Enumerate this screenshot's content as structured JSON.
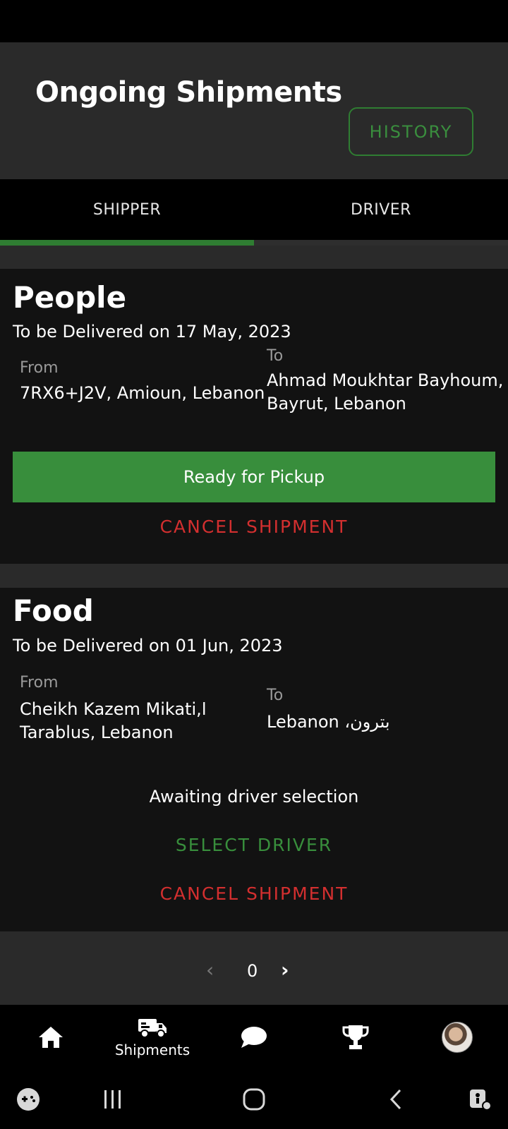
{
  "header": {
    "title": "Ongoing Shipments",
    "history_label": "HISTORY"
  },
  "tabs": [
    {
      "label": "SHIPPER",
      "selected": true
    },
    {
      "label": "DRIVER",
      "selected": false
    }
  ],
  "shipments": [
    {
      "type": "People",
      "delivery": "To be Delivered on 17 May, 2023",
      "from_label": "From",
      "from_lines": [
        "7RX6+J2V, Amioun, Lebanon"
      ],
      "to_label": "To",
      "to_lines": [
        "Ahmad Moukhtar Bayhoum,",
        "Bayrut, Lebanon"
      ],
      "action_label": "Ready for Pickup",
      "cancel_label": "CANCEL SHIPMENT"
    },
    {
      "type": "Food",
      "delivery": "To be Delivered on 01 Jun, 2023",
      "from_label": "From",
      "from_lines": [
        "Cheikh Kazem Mikati,ا",
        "Tarablus, Lebanon"
      ],
      "to_label": "To",
      "to_lines": [
        "Lebanon ،بترون"
      ],
      "status": "Awaiting driver selection",
      "select_driver_label": "SELECT DRIVER",
      "cancel_label": "CANCEL SHIPMENT"
    }
  ],
  "pager": {
    "prev": "‹",
    "page": "0",
    "next": "›"
  },
  "bottom_nav": [
    {
      "icon": "home-icon",
      "label": ""
    },
    {
      "icon": "truck-icon",
      "label": "Shipments",
      "selected": true
    },
    {
      "icon": "chat-icon",
      "label": ""
    },
    {
      "icon": "trophy-icon",
      "label": ""
    },
    {
      "icon": "avatar",
      "label": ""
    }
  ],
  "colors": {
    "accent_green": "#388e3c",
    "cancel_red": "#d32f2f",
    "card_bg": "#121212",
    "header_bg": "#2a2a2a"
  }
}
